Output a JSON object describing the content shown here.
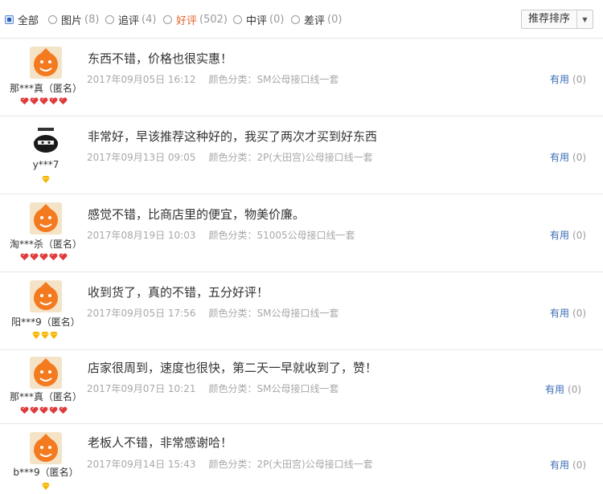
{
  "filters": [
    {
      "label": "全部",
      "count": "",
      "checked": true
    },
    {
      "label": "图片",
      "count": "(8)",
      "checked": false
    },
    {
      "label": "追评",
      "count": "(4)",
      "checked": false
    },
    {
      "label": "好评",
      "count": "(502)",
      "checked": false
    },
    {
      "label": "中评",
      "count": "(0)",
      "checked": false
    },
    {
      "label": "差评",
      "count": "(0)",
      "checked": false
    }
  ],
  "sort": {
    "label": "推荐排序",
    "icon": "caret-down-icon"
  },
  "reviews": [
    {
      "user": "那***真（匿名）",
      "text": " 东西不错，价格也很实惠！",
      "date": "2017年09月05日 16:12",
      "spec": "颜色分类：SM公母接口线一套",
      "useful_label": "有用",
      "useful_count": "(0)",
      "rank": "hearts",
      "rank_count": 5
    },
    {
      "user": "y***7",
      "text": "非常好，早该推荐这种好的，我买了两次才买到好东西",
      "date": "2017年09月13日 09:05",
      "spec": "颜色分类：2P(大田宫)公母接口线一套",
      "useful_label": "有用",
      "useful_count": "(0)",
      "rank": "diamonds",
      "rank_count": 1
    },
    {
      "user": "淘***杀（匿名）",
      "text": "感觉不错，比商店里的便宜，物美价廉。",
      "date": "2017年08月19日 10:03",
      "spec": "颜色分类：51005公母接口线一套",
      "useful_label": "有用",
      "useful_count": "(0)",
      "rank": "hearts",
      "rank_count": 5
    },
    {
      "user": "阳***9（匿名）",
      "text": "收到货了，真的不错，五分好评！",
      "date": "2017年09月05日 17:56",
      "spec": "颜色分类：SM公母接口线一套",
      "useful_label": "有用",
      "useful_count": "(0)",
      "rank": "diamonds",
      "rank_count": 3
    },
    {
      "user": "那***真（匿名）",
      "text": "店家很周到，速度也很快，第二天一早就收到了，赞！",
      "date": "2017年09月07日 10:21",
      "spec": "颜色分类：SM公母接口线一套",
      "useful_label": "有用",
      "useful_count": "(0)",
      "rank": "hearts",
      "rank_count": 5
    },
    {
      "user": "b***9（匿名）",
      "text": "老板人不错，非常感谢哈！",
      "date": "2017年09月14日 15:43",
      "spec": "颜色分类：2P(大田宫)公母接口线一套",
      "useful_label": "有用",
      "useful_count": "(0)",
      "rank": "diamonds",
      "rank_count": 1
    }
  ],
  "colors": {
    "accent_orange": "#e4632d",
    "link_blue": "#3a6cb5",
    "meta_gray": "#a8a8a8",
    "heart_red": "#e03a3a",
    "diamond_gold": "#f5b400"
  }
}
